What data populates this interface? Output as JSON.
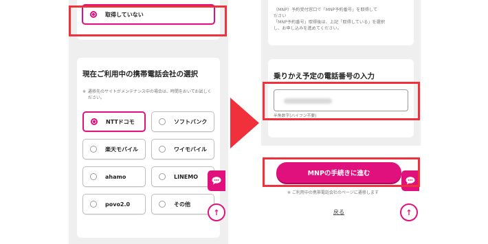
{
  "left_screen": {
    "not_acquired_option": "取得していない",
    "carrier_section": {
      "title": "現在ご利用中の携帯電話会社の選択",
      "note_mark": "※",
      "note": "遷移先のサイトがメンテナンス中の場合は、時間をおいてお試しください。",
      "options": [
        {
          "label": "NTTドコモ",
          "selected": true
        },
        {
          "label": "ソフトバンク",
          "selected": false
        },
        {
          "label": "楽天モバイル",
          "selected": false
        },
        {
          "label": "ワイモバイル",
          "selected": false
        },
        {
          "label": "ahamo",
          "selected": false
        },
        {
          "label": "LINEMO",
          "selected": false
        },
        {
          "label": "povo2.0",
          "selected": false
        },
        {
          "label": "その他",
          "selected": false
        }
      ]
    },
    "top_button": "↑"
  },
  "right_screen": {
    "top_note_line1": "（MNP）予約受付窓口で「MNP予約番号」を取得して",
    "top_note_line2": "ださい",
    "top_note_line3": "「MNP予約番号」取得後は、上記「取得している」を選択",
    "top_note_line4": "し、お申し込みを進めてください。",
    "phone_section_title": "乗りかえ予定の電話番号の入力",
    "input_hint": "半角数字(ハイフン不要)",
    "submit_button": "MNPの手続きに進む",
    "redirect_note": "※ ご利用中の携帯電話会社のページに遷移します",
    "back_link": "戻る",
    "top_button": "↑"
  },
  "colors": {
    "accent": "#e0107d",
    "highlight_box": "#f0313b",
    "arrow": "#f0313b"
  },
  "icons": {
    "chat": "chat-bubble-icon",
    "scroll_top": "arrow-up-icon",
    "flow": "right-arrow-icon"
  }
}
